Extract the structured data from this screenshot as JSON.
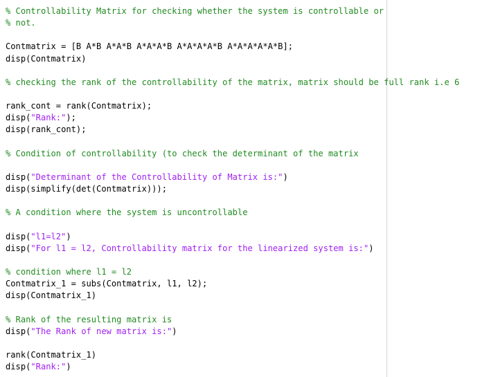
{
  "editor": {
    "lines": [
      {
        "segments": [
          {
            "type": "comment",
            "text": "% Controllability Matrix for checking whether the system is controllable or"
          }
        ]
      },
      {
        "segments": [
          {
            "type": "comment",
            "text": "% not."
          }
        ]
      },
      {
        "segments": []
      },
      {
        "segments": [
          {
            "type": "plain",
            "text": "Contmatrix = [B A*B A*A*B A*A*A*B A*A*A*A*B A*A*A*A*A*B];"
          }
        ]
      },
      {
        "segments": [
          {
            "type": "plain",
            "text": "disp(Contmatrix)"
          }
        ]
      },
      {
        "segments": []
      },
      {
        "segments": [
          {
            "type": "comment",
            "text": "% checking the rank of the controllability of the matrix, matrix should be full rank i.e 6"
          }
        ]
      },
      {
        "segments": []
      },
      {
        "segments": [
          {
            "type": "plain",
            "text": "rank_cont = rank(Contmatrix);"
          }
        ]
      },
      {
        "segments": [
          {
            "type": "plain",
            "text": "disp("
          },
          {
            "type": "str",
            "text": "\"Rank:\""
          },
          {
            "type": "plain",
            "text": ");"
          }
        ]
      },
      {
        "segments": [
          {
            "type": "plain",
            "text": "disp(rank_cont);"
          }
        ]
      },
      {
        "segments": []
      },
      {
        "segments": [
          {
            "type": "comment",
            "text": "% Condition of controllability (to check the determinant of the matrix"
          }
        ]
      },
      {
        "segments": []
      },
      {
        "segments": [
          {
            "type": "plain",
            "text": "disp("
          },
          {
            "type": "str",
            "text": "\"Determinant of the Controllability of Matrix is:\""
          },
          {
            "type": "plain",
            "text": ")"
          }
        ]
      },
      {
        "segments": [
          {
            "type": "plain",
            "text": "disp(simplify(det(Contmatrix)));"
          }
        ]
      },
      {
        "segments": []
      },
      {
        "segments": [
          {
            "type": "comment",
            "text": "% A condition where the system is uncontrollable"
          }
        ]
      },
      {
        "segments": []
      },
      {
        "segments": [
          {
            "type": "plain",
            "text": "disp("
          },
          {
            "type": "str",
            "text": "\"l1=l2\""
          },
          {
            "type": "plain",
            "text": ")"
          }
        ]
      },
      {
        "segments": [
          {
            "type": "plain",
            "text": "disp("
          },
          {
            "type": "str",
            "text": "\"For l1 = l2, Controllability matrix for the linearized system is:\""
          },
          {
            "type": "plain",
            "text": ")"
          }
        ]
      },
      {
        "segments": []
      },
      {
        "segments": [
          {
            "type": "comment",
            "text": "% condition where l1 = l2"
          }
        ]
      },
      {
        "segments": [
          {
            "type": "plain",
            "text": "Contmatrix_1 = subs(Contmatrix, l1, l2);"
          }
        ]
      },
      {
        "segments": [
          {
            "type": "plain",
            "text": "disp(Contmatrix_1)"
          }
        ]
      },
      {
        "segments": []
      },
      {
        "segments": [
          {
            "type": "comment",
            "text": "% Rank of the resulting matrix is"
          }
        ]
      },
      {
        "segments": [
          {
            "type": "plain",
            "text": "disp("
          },
          {
            "type": "str",
            "text": "\"The Rank of new matrix is:\""
          },
          {
            "type": "plain",
            "text": ")"
          }
        ]
      },
      {
        "segments": []
      },
      {
        "segments": [
          {
            "type": "plain",
            "text": "rank(Contmatrix_1)"
          }
        ]
      },
      {
        "segments": [
          {
            "type": "plain",
            "text": "disp("
          },
          {
            "type": "str",
            "text": "\"Rank:\""
          },
          {
            "type": "plain",
            "text": ")"
          }
        ]
      }
    ]
  },
  "colors": {
    "comment": "#228b22",
    "string": "#a020f0",
    "code": "#000000",
    "background": "#ffffff",
    "margin_line": "#d4d4d4"
  }
}
